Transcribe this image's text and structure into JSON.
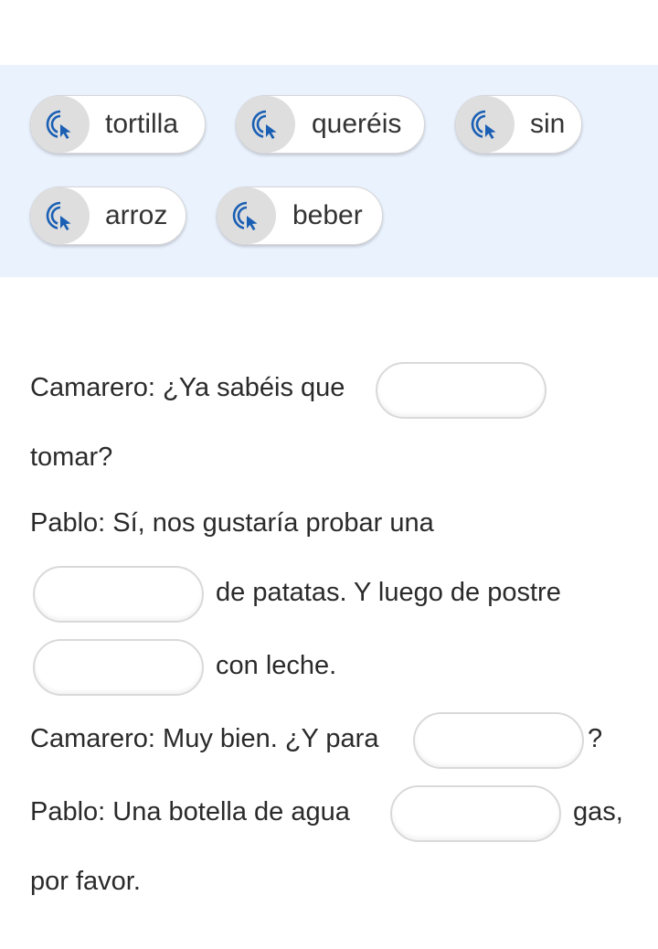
{
  "word_bank": {
    "icon": "drag-cursor-icon",
    "accent_color": "#1a5fb4",
    "chips": [
      "tortilla",
      "queréis",
      "sin",
      "arroz",
      "beber"
    ]
  },
  "exercise": {
    "line1_text": "Camarero: ¿Ya sabéis que",
    "line2_text": "tomar?",
    "line3_text": "Pablo: Sí, nos gustaría probar una",
    "line4_text": "de patatas. Y luego de postre",
    "line5_text": "con leche.",
    "line6_text": "Camarero: Muy bien. ¿Y para",
    "line6_end": "?",
    "line7_text": "Pablo: Una botella de agua",
    "line7_end": "gas,",
    "line8_text": "por favor."
  }
}
